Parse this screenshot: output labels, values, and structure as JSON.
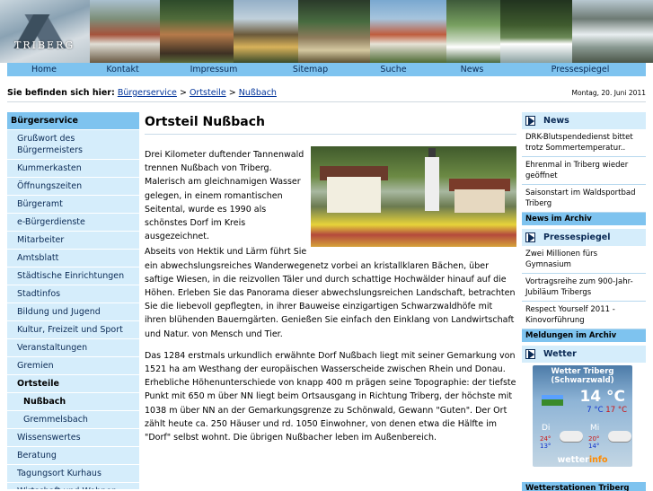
{
  "site": {
    "logo_text": "TRIBERG"
  },
  "nav": [
    "Home",
    "Kontakt",
    "Impressum",
    "Sitemap",
    "Suche",
    "News",
    "Pressespiegel"
  ],
  "breadcrumb": {
    "prefix": "Sie befinden sich hier:",
    "items": [
      "Bürgerservice",
      "Ortsteile",
      "Nußbach"
    ],
    "separator": ">",
    "date": "Montag, 20. Juni 2011"
  },
  "sidebar": {
    "heading": "Bürgerservice",
    "items": [
      "Grußwort des Bürgermeisters",
      "Kummerkasten",
      "Öffnungszeiten",
      "Bürgeramt",
      "e-Bürgerdienste",
      "Mitarbeiter",
      "Amtsblatt",
      "Städtische Einrichtungen",
      "Stadtinfos",
      "Bildung und Jugend",
      "Kultur, Freizeit und Sport",
      "Veranstaltungen",
      "Gremien",
      "Ortsteile",
      "Nußbach",
      "Gremmelsbach",
      "Wissenswertes",
      "Beratung",
      "Tagungsort Kurhaus",
      "Wirtschaft und Wohnen"
    ]
  },
  "main": {
    "title": "Ortsteil Nußbach",
    "paragraph1": "Drei Kilometer duftender Tannenwald trennen Nußbach von Triberg. Malerisch am gleichnamigen Wasser gelegen, in einem romantischen Seitental, wurde es 1990 als schönstes Dorf im Kreis ausgezeichnet.",
    "paragraph1b": "Abseits von Hektik und Lärm führt Sie ein abwechslungsreiches Wanderwegenetz vorbei an kristallklaren Bächen, über saftige Wiesen, in die reizvollen Täler und durch schattige Hochwälder hinauf auf die Höhen. Erleben Sie das Panorama dieser abwechslungsreichen Landschaft, betrachten Sie die liebevoll gepflegten, in ihrer Bauweise einzigartigen Schwarzwaldhöfe mit ihren blühenden Bauerngärten. Genießen Sie einfach den Einklang von Landwirtschaft und Natur. von Mensch und Tier.",
    "paragraph2": "Das 1284 erstmals urkundlich erwähnte Dorf Nußbach liegt mit seiner Gemarkung von 1521 ha am Westhang der europäischen Wasserscheide zwischen Rhein und Donau. Erhebliche Höhenunterschiede von knapp 400 m prägen seine Topographie: der tiefste Punkt mit 650 m über NN liegt beim Ortsausgang in Richtung Triberg, der höchste mit 1038 m über NN an der Gemarkungsgrenze zu Schönwald, Gewann \"Guten\". Der Ort zählt heute ca. 250 Häuser und rd. 1050 Einwohner, von denen etwa die Hälfte im \"Dorf\" selbst wohnt. Die übrigen Nußbacher leben im Außenbereich."
  },
  "right": {
    "news": {
      "heading": "News",
      "items": [
        "DRK-Blutspendedienst bittet trotz Sommertemperatur..",
        "Ehrenmal in Triberg wieder geöffnet",
        "Saisonstart im Waldsportbad Triberg"
      ],
      "archive": "News im Archiv"
    },
    "press": {
      "heading": "Pressespiegel",
      "items": [
        "Zwei Millionen fürs Gymnasium",
        "Vortragsreihe zum 900-Jahr-Jubiläum Tribergs",
        "Respect Yourself 2011 - Kinovorführung"
      ],
      "archive": "Meldungen im Archiv"
    },
    "weather": {
      "heading": "Wetter",
      "title_line1": "Wetter Triberg",
      "title_line2": "(Schwarzwald)",
      "temp": "14 °C",
      "min": "7 °C",
      "max": "17 °C",
      "day1": "Di",
      "day2": "Mi",
      "day1_max": "24°",
      "day1_min": "13°",
      "day2_max": "20°",
      "day2_min": "14°",
      "logo_main": "wetter",
      "logo_accent": "info",
      "footer": "Wetterstationen Triberg"
    }
  }
}
